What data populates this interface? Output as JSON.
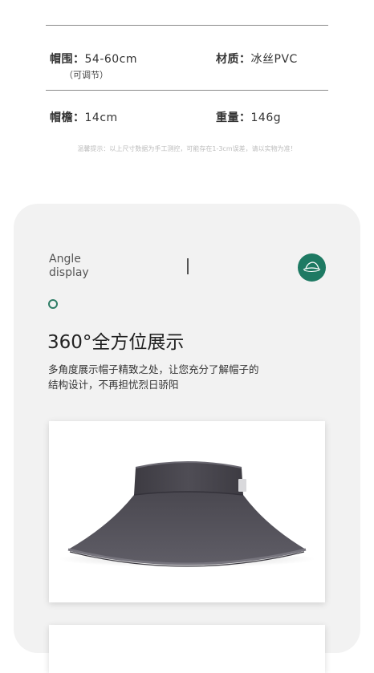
{
  "specs": {
    "circumference_label": "帽围：",
    "circumference_value": "54-60cm",
    "adjustable_note": "（可调节）",
    "material_label": "材质：",
    "material_value": "冰丝PVC",
    "brim_label": "帽檐：",
    "brim_value": "14cm",
    "weight_label": "重量：",
    "weight_value": "146g"
  },
  "tip": "温馨提示：以上尺寸数据为手工测控，可能存在1-3cm误差，请以实物为准！",
  "section": {
    "eyebrow_line1": "Angle",
    "eyebrow_line2": "display",
    "title": "360°全方位展示",
    "desc_line1": "多角度展示帽子精致之处，让您充分了解帽子的",
    "desc_line2": "结构设计，不再担忧烈日骄阳"
  },
  "colors": {
    "accent": "#1e7a63",
    "hat": "#56545d",
    "panel": "#f2f2f2"
  }
}
